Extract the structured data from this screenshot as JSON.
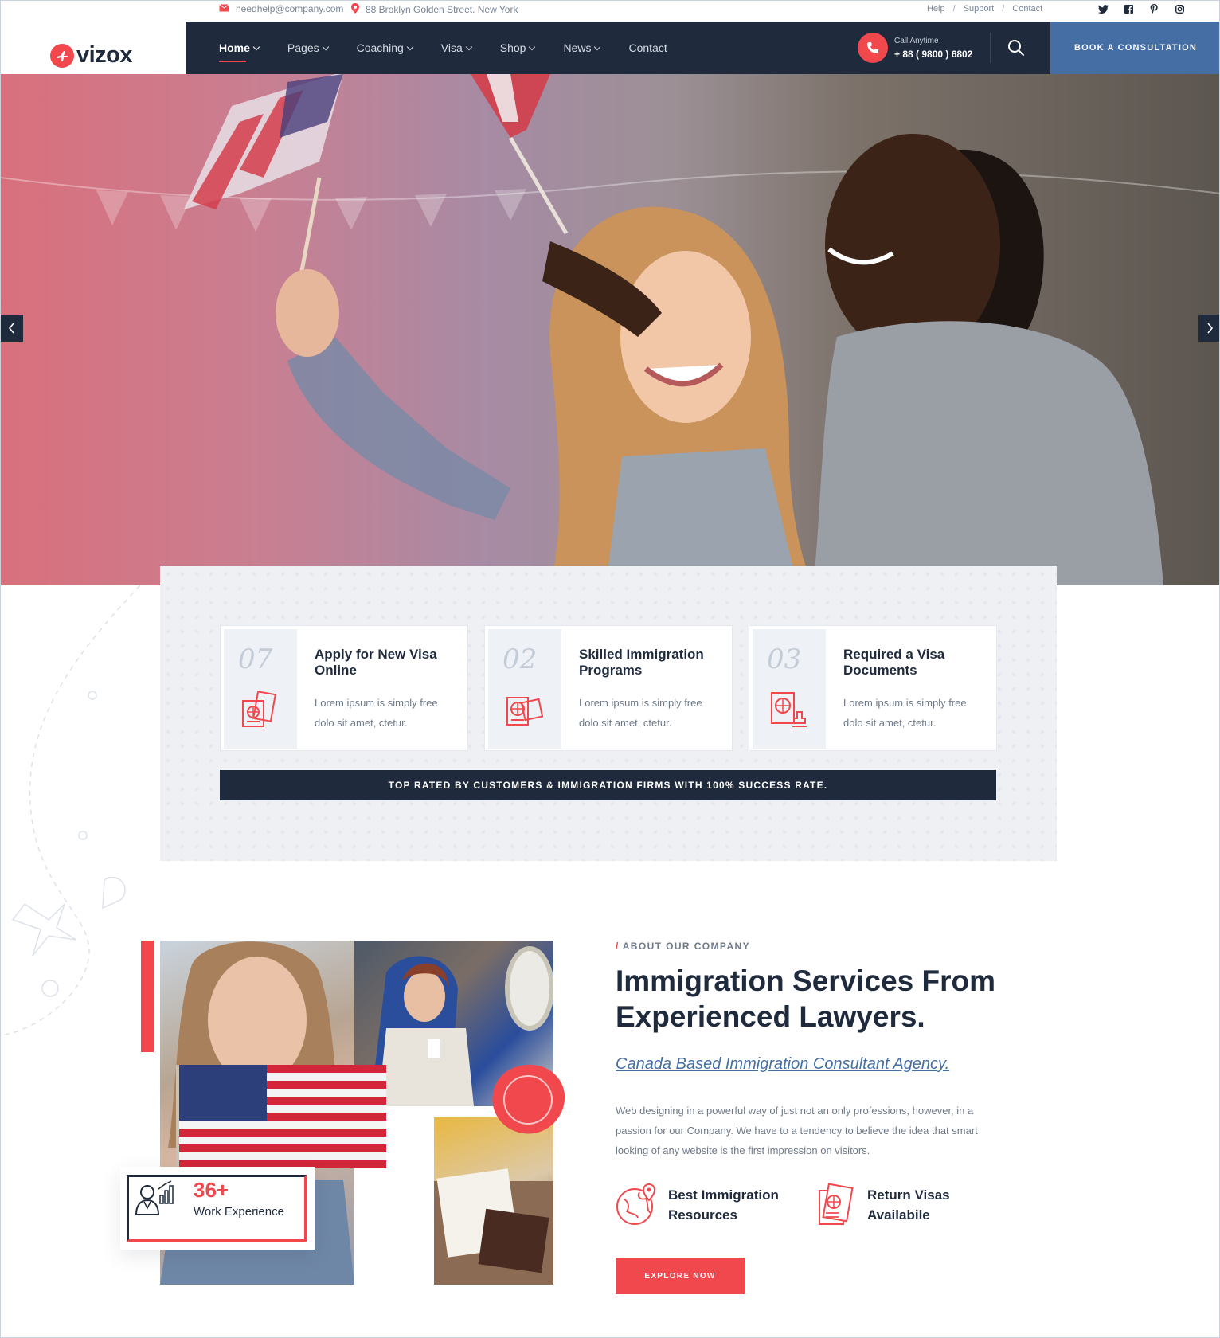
{
  "topbar": {
    "email": "needhelp@company.com",
    "address": "88 Broklyn Golden Street. New York",
    "links": [
      "Help",
      "Support",
      "Contact"
    ],
    "social_icons": [
      "twitter-icon",
      "facebook-icon",
      "pinterest-icon",
      "instagram-icon"
    ]
  },
  "brand": {
    "name": "vizox",
    "accent": "#f0484d",
    "dark": "#1f2b3d",
    "blue": "#456fa4"
  },
  "nav": {
    "items": [
      {
        "label": "Home",
        "dropdown": true,
        "active": true
      },
      {
        "label": "Pages",
        "dropdown": true
      },
      {
        "label": "Coaching",
        "dropdown": true
      },
      {
        "label": "Visa",
        "dropdown": true
      },
      {
        "label": "Shop",
        "dropdown": true
      },
      {
        "label": "News",
        "dropdown": true
      },
      {
        "label": "Contact",
        "dropdown": false
      }
    ],
    "call_label": "Call Anytime",
    "call_number": "+ 88 ( 9800 ) 6802",
    "book_label": "BOOK A CONSULTATION"
  },
  "features": {
    "cards": [
      {
        "number": "07",
        "title": "Apply for New Visa Online",
        "desc": "Lorem ipsum is simply free dolo sit amet, ctetur.",
        "icon": "passport-globe-icon"
      },
      {
        "number": "02",
        "title": "Skilled Immigration Programs",
        "desc": "Lorem ipsum is simply free dolo sit amet, ctetur.",
        "icon": "visa-documents-icon"
      },
      {
        "number": "03",
        "title": "Required a Visa Documents",
        "desc": "Lorem ipsum is simply free dolo sit amet, ctetur.",
        "icon": "passport-stamp-icon"
      }
    ],
    "banner": "TOP RATED BY CUSTOMERS & IMMIGRATION FIRMS WITH 100% SUCCESS RATE."
  },
  "about": {
    "tag": "ABOUT OUR COMPANY",
    "title": "Immigration Services From Experienced Lawyers.",
    "subtitle": "Canada Based Immigration Consultant Agency.",
    "paragraph": "Web designing in a powerful way of just not an only professions, however, in a passion for our Company. We have to a tendency to believe the idea that smart looking of any website is the first impression on visitors.",
    "points": [
      {
        "text": "Best Immigration Resources",
        "icon": "globe-location-icon"
      },
      {
        "text": "Return Visas Availabile",
        "icon": "passport-icon"
      }
    ],
    "button": "EXPLORE NOW",
    "experience_number": "36+",
    "experience_label": "Work Experience"
  }
}
